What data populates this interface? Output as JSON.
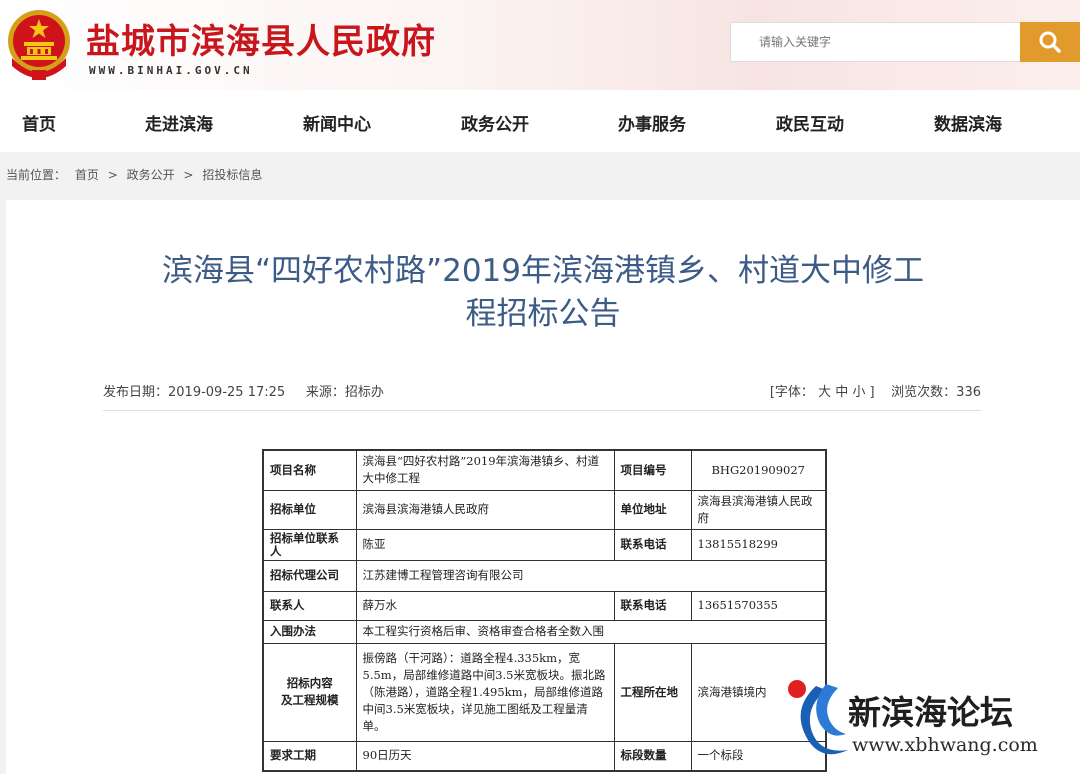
{
  "header": {
    "site_title": "盐城市滨海县人民政府",
    "site_domain": "WWW.BINHAI.GOV.CN",
    "search_placeholder": "请输入关键字",
    "brand_color": "#c8161d",
    "search_button_color": "#e29a2c",
    "emblem_icon": "national-emblem-icon",
    "search_icon": "search-icon"
  },
  "nav": {
    "items": [
      "首页",
      "走进滨海",
      "新闻中心",
      "政务公开",
      "办事服务",
      "政民互动",
      "数据滨海"
    ]
  },
  "breadcrumb": {
    "label": "当前位置：",
    "items": [
      "首页",
      "政务公开",
      "招投标信息"
    ],
    "separator": ">"
  },
  "article": {
    "title_line1": "滨海县“四好农村路”2019年滨海港镇乡、村道大中修工",
    "title_line2": "程招标公告",
    "title_color": "#3c5b86",
    "publish_label": "发布日期：",
    "publish_date": "2019-09-25 17:25",
    "source_label": "来源：",
    "source": "招标办",
    "font_label": "[字体：",
    "font_big": "大",
    "font_mid": "中",
    "font_small": "小",
    "font_close": "]",
    "views_label": "浏览次数：",
    "views": "336"
  },
  "table": {
    "project_name_label": "项目名称",
    "project_name": "滨海县“四好农村路”2019年滨海港镇乡、村道大中修工程",
    "project_no_label": "项目编号",
    "project_no": "BHG201909027",
    "tender_unit_label": "招标单位",
    "tender_unit": "滨海县滨海港镇人民政府",
    "unit_address_label": "单位地址",
    "unit_address": "滨海县滨海港镇人民政府",
    "tender_contact_label": "招标单位联系人",
    "tender_contact": "陈亚",
    "phone_label": "联系电话",
    "tender_phone": "13815518299",
    "agent_label": "招标代理公司",
    "agent": "江苏建博工程管理咨询有限公司",
    "agent_contact_label": "联系人",
    "agent_contact": "薛万水",
    "agent_phone": "13651570355",
    "method_label": "入围办法",
    "method": "本工程实行资格后审、资格审查合格者全数入围",
    "content_label_1": "招标内容",
    "content_label_2": "及工程规模",
    "content": "振傍路（干河路）：道路全程4.335km，宽5.5m，局部维修道路中间3.5米宽板块。振北路（陈港路），道路全程1.495km，局部维修道路中间3.5米宽板块，详见施工图纸及工程量清单。",
    "location_label": "工程所在地",
    "location": "滨海港镇境内",
    "period_label": "要求工期",
    "period": "90日历天",
    "lots_label": "标段数量",
    "lots": "一个标段"
  },
  "watermark": {
    "title": "新滨海论坛",
    "url": "www.xbhwang.com",
    "logo_icon": "forum-logo-icon",
    "logo_blue": "#1a5fb4",
    "logo_red": "#e02020"
  }
}
